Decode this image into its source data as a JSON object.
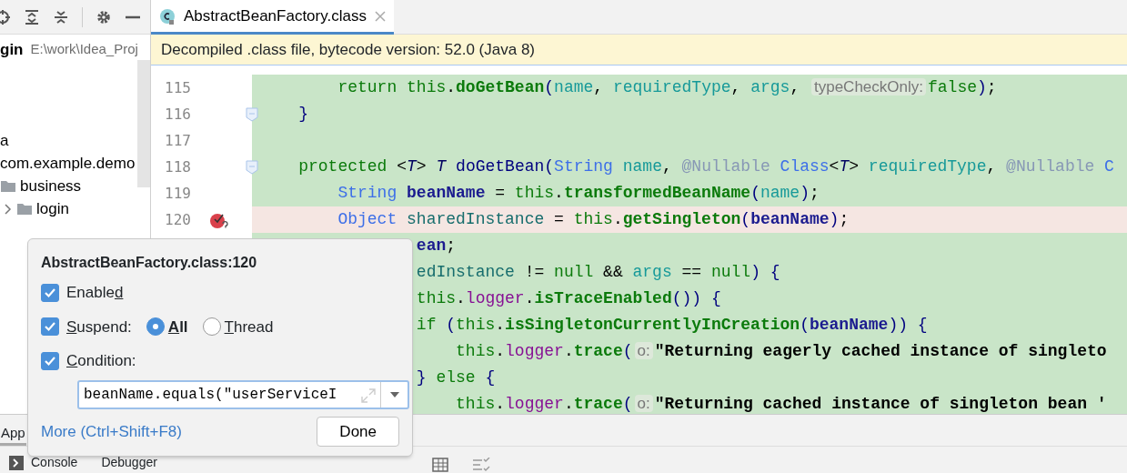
{
  "project_panel": {
    "root": {
      "name": "gin",
      "path": "E:\\work\\Idea_Proj"
    },
    "items": [
      {
        "label": "a"
      },
      {
        "label": "com.example.demo",
        "children": [
          {
            "label": "business",
            "children": [
              {
                "label": "login",
                "expanded": false
              }
            ]
          }
        ]
      }
    ]
  },
  "editor": {
    "tabs": [
      {
        "label": "AbstractBeanFactory.class",
        "selected": true
      }
    ],
    "banner": "Decompiled .class file, bytecode version: 52.0 (Java 8)",
    "lines": [
      {
        "num": "115",
        "tokens": [
          {
            "text": "        return ",
            "kind": "kw"
          },
          {
            "text": "this",
            "kind": "kw"
          },
          {
            "text": ".",
            "kind": "p"
          },
          {
            "text": "doGetBean",
            "kind": "call"
          },
          {
            "text": "(",
            "kind": "pn"
          },
          {
            "text": "name",
            "kind": "param"
          },
          {
            "text": ", ",
            "kind": "p"
          },
          {
            "text": "requiredType",
            "kind": "param"
          },
          {
            "text": ", ",
            "kind": "p"
          },
          {
            "text": "args",
            "kind": "param"
          },
          {
            "text": ", ",
            "kind": "p"
          },
          {
            "text": "typeCheckOnly:",
            "kind": "hint"
          },
          {
            "text": "false",
            "kind": "kw"
          },
          {
            "text": ")",
            "kind": "pn"
          },
          {
            "text": ";",
            "kind": "p"
          }
        ]
      },
      {
        "num": "116",
        "fold": true,
        "tokens": [
          {
            "text": "    }",
            "kind": "pn"
          }
        ]
      },
      {
        "num": "117"
      },
      {
        "num": "118",
        "fold": true,
        "tokens": [
          {
            "text": "    protected ",
            "kind": "kw"
          },
          {
            "text": "<",
            "kind": "p"
          },
          {
            "text": "T",
            "kind": "tp"
          },
          {
            "text": "> ",
            "kind": "p"
          },
          {
            "text": "T ",
            "kind": "tp"
          },
          {
            "text": "doGetBean",
            "kind": "decl"
          },
          {
            "text": "(",
            "kind": "pn"
          },
          {
            "text": "String ",
            "kind": "type"
          },
          {
            "text": "name",
            "kind": "param"
          },
          {
            "text": ", ",
            "kind": "p"
          },
          {
            "text": "@Nullable ",
            "kind": "anno"
          },
          {
            "text": "Class",
            "kind": "type"
          },
          {
            "text": "<",
            "kind": "p"
          },
          {
            "text": "T",
            "kind": "tp"
          },
          {
            "text": "> ",
            "kind": "p"
          },
          {
            "text": "requiredType",
            "kind": "param"
          },
          {
            "text": ", ",
            "kind": "p"
          },
          {
            "text": "@Nullable ",
            "kind": "anno"
          },
          {
            "text": "C",
            "kind": "type"
          }
        ]
      },
      {
        "num": "119",
        "tokens": [
          {
            "text": "        String ",
            "kind": "type"
          },
          {
            "text": "beanName",
            "kind": "local"
          },
          {
            "text": " = ",
            "kind": "p"
          },
          {
            "text": "this",
            "kind": "kw"
          },
          {
            "text": ".",
            "kind": "p"
          },
          {
            "text": "transformedBeanName",
            "kind": "call"
          },
          {
            "text": "(",
            "kind": "pn"
          },
          {
            "text": "name",
            "kind": "param"
          },
          {
            "text": ")",
            "kind": "pn"
          },
          {
            "text": ";",
            "kind": "p"
          }
        ]
      },
      {
        "num": "120",
        "breakpoint": true,
        "highlighted": true,
        "tokens": [
          {
            "text": "        Object ",
            "kind": "type"
          },
          {
            "text": "sharedInstance",
            "kind": "var"
          },
          {
            "text": " = ",
            "kind": "p"
          },
          {
            "text": "this",
            "kind": "kw"
          },
          {
            "text": ".",
            "kind": "p"
          },
          {
            "text": "getSingleton",
            "kind": "call"
          },
          {
            "text": "(",
            "kind": "pn"
          },
          {
            "text": "beanName",
            "kind": "local"
          },
          {
            "text": ")",
            "kind": "pn"
          },
          {
            "text": ";",
            "kind": "p"
          }
        ]
      },
      {
        "tokens": [
          {
            "text": "                ean",
            "kind": "local"
          },
          {
            "text": ";",
            "kind": "p"
          }
        ]
      },
      {
        "tokens": [
          {
            "text": "                edInstance",
            "kind": "var"
          },
          {
            "text": " != ",
            "kind": "p"
          },
          {
            "text": "null",
            "kind": "kw"
          },
          {
            "text": " && ",
            "kind": "p"
          },
          {
            "text": "args",
            "kind": "param"
          },
          {
            "text": " == ",
            "kind": "p"
          },
          {
            "text": "null",
            "kind": "kw"
          },
          {
            "text": ") {",
            "kind": "pn"
          }
        ]
      },
      {
        "tokens": [
          {
            "text": "                this",
            "kind": "kw"
          },
          {
            "text": ".",
            "kind": "p"
          },
          {
            "text": "logger",
            "kind": "field"
          },
          {
            "text": ".",
            "kind": "p"
          },
          {
            "text": "isTraceEnabled",
            "kind": "call"
          },
          {
            "text": "()) {",
            "kind": "pn"
          }
        ]
      },
      {
        "tokens": [
          {
            "text": "                if ",
            "kind": "kw"
          },
          {
            "text": "(",
            "kind": "pn"
          },
          {
            "text": "this",
            "kind": "kw"
          },
          {
            "text": ".",
            "kind": "p"
          },
          {
            "text": "isSingletonCurrentlyInCreation",
            "kind": "call"
          },
          {
            "text": "(",
            "kind": "pn"
          },
          {
            "text": "beanName",
            "kind": "local"
          },
          {
            "text": ")) {",
            "kind": "pn"
          }
        ]
      },
      {
        "tokens": [
          {
            "text": "                    this",
            "kind": "kw"
          },
          {
            "text": ".",
            "kind": "p"
          },
          {
            "text": "logger",
            "kind": "field"
          },
          {
            "text": ".",
            "kind": "p"
          },
          {
            "text": "trace",
            "kind": "call"
          },
          {
            "text": "(",
            "kind": "pn"
          },
          {
            "text": "o:",
            "kind": "hint"
          },
          {
            "text": "\"Returning eagerly cached instance of singleto",
            "kind": "str"
          }
        ]
      },
      {
        "tokens": [
          {
            "text": "                } ",
            "kind": "pn"
          },
          {
            "text": "else ",
            "kind": "kw"
          },
          {
            "text": "{",
            "kind": "pn"
          }
        ]
      },
      {
        "tokens": [
          {
            "text": "                    this",
            "kind": "kw"
          },
          {
            "text": ".",
            "kind": "p"
          },
          {
            "text": "logger",
            "kind": "field"
          },
          {
            "text": ".",
            "kind": "p"
          },
          {
            "text": "trace",
            "kind": "call"
          },
          {
            "text": "(",
            "kind": "pn"
          },
          {
            "text": "o:",
            "kind": "hint"
          },
          {
            "text": "\"Returning cached instance of singleton bean '",
            "kind": "str"
          }
        ]
      }
    ]
  },
  "breakpoint_popup": {
    "title": "AbstractBeanFactory.class:120",
    "enabled": {
      "label": {
        "before": "Enable",
        "key": "d"
      },
      "checked": true
    },
    "suspend": {
      "label": {
        "key": "S",
        "after": "uspend:"
      },
      "checked": true,
      "options": [
        {
          "label": {
            "key": "A",
            "after": "ll"
          },
          "selected": true
        },
        {
          "label": {
            "key": "T",
            "after": "hread"
          },
          "selected": false
        }
      ]
    },
    "condition": {
      "label": {
        "key": "C",
        "after": "ondition:"
      },
      "checked": true,
      "value": "beanName.equals(\"userServiceI"
    },
    "more_link": "More (Ctrl+Shift+F8)",
    "done_button": "Done"
  },
  "tool_window": {
    "tab": "App",
    "toolbar": [
      {
        "label": "Console"
      },
      {
        "label": "Debugger"
      }
    ]
  }
}
